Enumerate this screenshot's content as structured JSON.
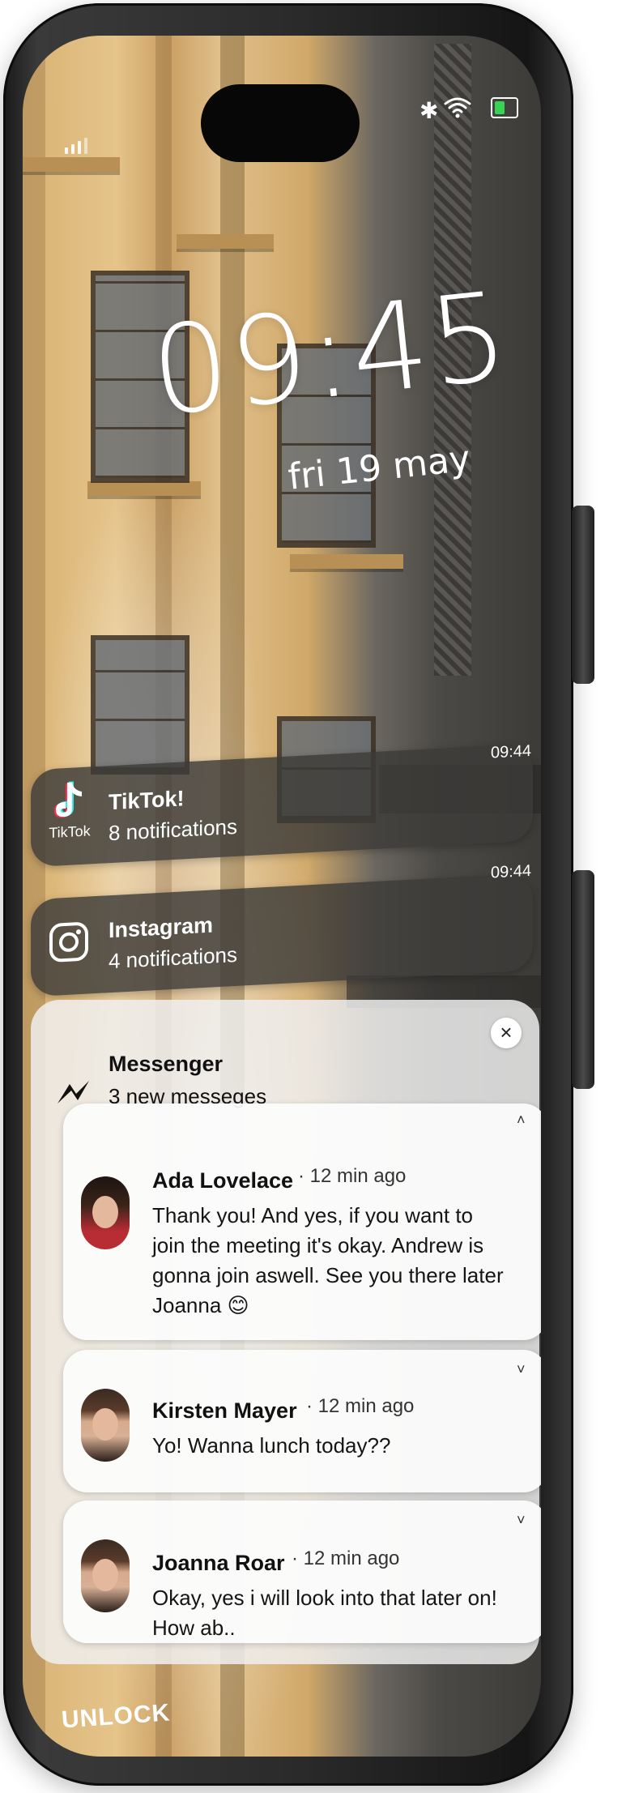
{
  "status_bar": {
    "signal_icon": "cell-signal-icon",
    "bluetooth_icon": "bluetooth-icon",
    "wifi_icon": "wifi-icon",
    "battery_icon": "battery-icon",
    "battery_color": "#39d353"
  },
  "lock_screen": {
    "time": "09:45",
    "date": "fri 19 may",
    "unlock_label": "UNLOCK"
  },
  "notifications": {
    "tiktok": {
      "app": "TikTok!",
      "icon_label": "TikTok",
      "summary": "8 notifications",
      "time": "09:44"
    },
    "instagram": {
      "app": "Instagram",
      "summary": "4 notifications",
      "time": "09:44"
    },
    "messenger": {
      "app": "Messenger",
      "summary": "3 new messeges",
      "close_label": "×",
      "messages": [
        {
          "sender": "Ada Lovelace",
          "time": "· 12 min ago",
          "text": "Thank you! And yes, if you want to join the meeting it's okay. Andrew is gonna join aswell. See you there later Joanna 😊",
          "chevron": "˄"
        },
        {
          "sender": "Kirsten Mayer",
          "time": "· 12 min ago",
          "text": "Yo! Wanna lunch today??",
          "chevron": "˅"
        },
        {
          "sender": "Joanna Roar",
          "time": "· 12 min ago",
          "text": "Okay, yes i will look into that later on! How ab..",
          "chevron": "˅"
        }
      ]
    }
  }
}
